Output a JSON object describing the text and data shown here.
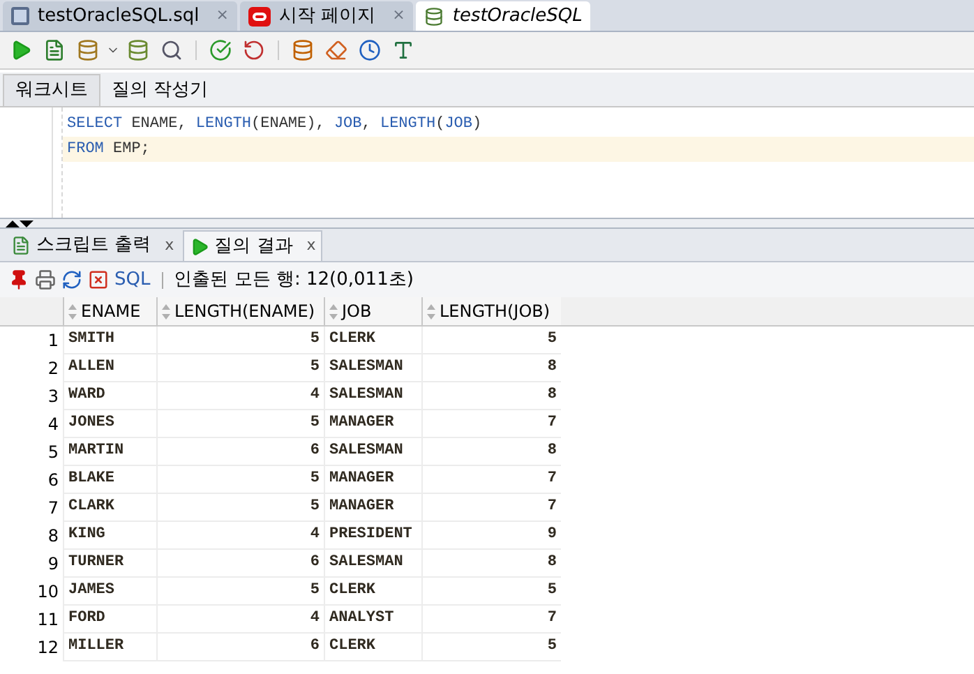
{
  "editor_tabs": [
    {
      "label": "testOracleSQL.sql",
      "kind": "file",
      "selected": false,
      "close": "×"
    },
    {
      "label": "시작 페이지",
      "kind": "start",
      "selected": false,
      "close": "×"
    },
    {
      "label": "testOracleSQL",
      "kind": "connection",
      "selected": true
    }
  ],
  "sub_tabs": [
    {
      "label": "워크시트",
      "selected": true
    },
    {
      "label": "질의 작성기",
      "selected": false
    }
  ],
  "code_lines": [
    {
      "tokens": [
        {
          "text": "SELECT",
          "kind": "keyword"
        },
        {
          "text": " ENAME, ",
          "kind": "ident"
        },
        {
          "text": "LENGTH",
          "kind": "keyword"
        },
        {
          "text": "(ENAME), ",
          "kind": "ident"
        },
        {
          "text": "JOB",
          "kind": "keyword"
        },
        {
          "text": ", ",
          "kind": "ident"
        },
        {
          "text": "LENGTH",
          "kind": "keyword"
        },
        {
          "text": "(",
          "kind": "ident"
        },
        {
          "text": "JOB",
          "kind": "keyword"
        },
        {
          "text": ")",
          "kind": "ident"
        }
      ],
      "current": false
    },
    {
      "tokens": [
        {
          "text": "FROM",
          "kind": "keyword"
        },
        {
          "text": " EMP;",
          "kind": "ident"
        }
      ],
      "current": true
    }
  ],
  "result_tabs": [
    {
      "label": "스크립트 출력",
      "kind": "script",
      "selected": false,
      "close": "x"
    },
    {
      "label": "질의 결과",
      "kind": "query",
      "selected": true,
      "close": "x"
    }
  ],
  "result_toolbar": {
    "sql_link": "SQL",
    "status": "인출된 모든 행: 12(0,011초)"
  },
  "table": {
    "columns": [
      "",
      "ENAME",
      "LENGTH(ENAME)",
      "JOB",
      "LENGTH(JOB)"
    ],
    "rows": [
      [
        "1",
        "SMITH",
        "5",
        "CLERK",
        "5"
      ],
      [
        "2",
        "ALLEN",
        "5",
        "SALESMAN",
        "8"
      ],
      [
        "3",
        "WARD",
        "4",
        "SALESMAN",
        "8"
      ],
      [
        "4",
        "JONES",
        "5",
        "MANAGER",
        "7"
      ],
      [
        "5",
        "MARTIN",
        "6",
        "SALESMAN",
        "8"
      ],
      [
        "6",
        "BLAKE",
        "5",
        "MANAGER",
        "7"
      ],
      [
        "7",
        "CLARK",
        "5",
        "MANAGER",
        "7"
      ],
      [
        "8",
        "KING",
        "4",
        "PRESIDENT",
        "9"
      ],
      [
        "9",
        "TURNER",
        "6",
        "SALESMAN",
        "8"
      ],
      [
        "10",
        "JAMES",
        "5",
        "CLERK",
        "5"
      ],
      [
        "11",
        "FORD",
        "4",
        "ANALYST",
        "7"
      ],
      [
        "12",
        "MILLER",
        "6",
        "CLERK",
        "5"
      ]
    ]
  }
}
